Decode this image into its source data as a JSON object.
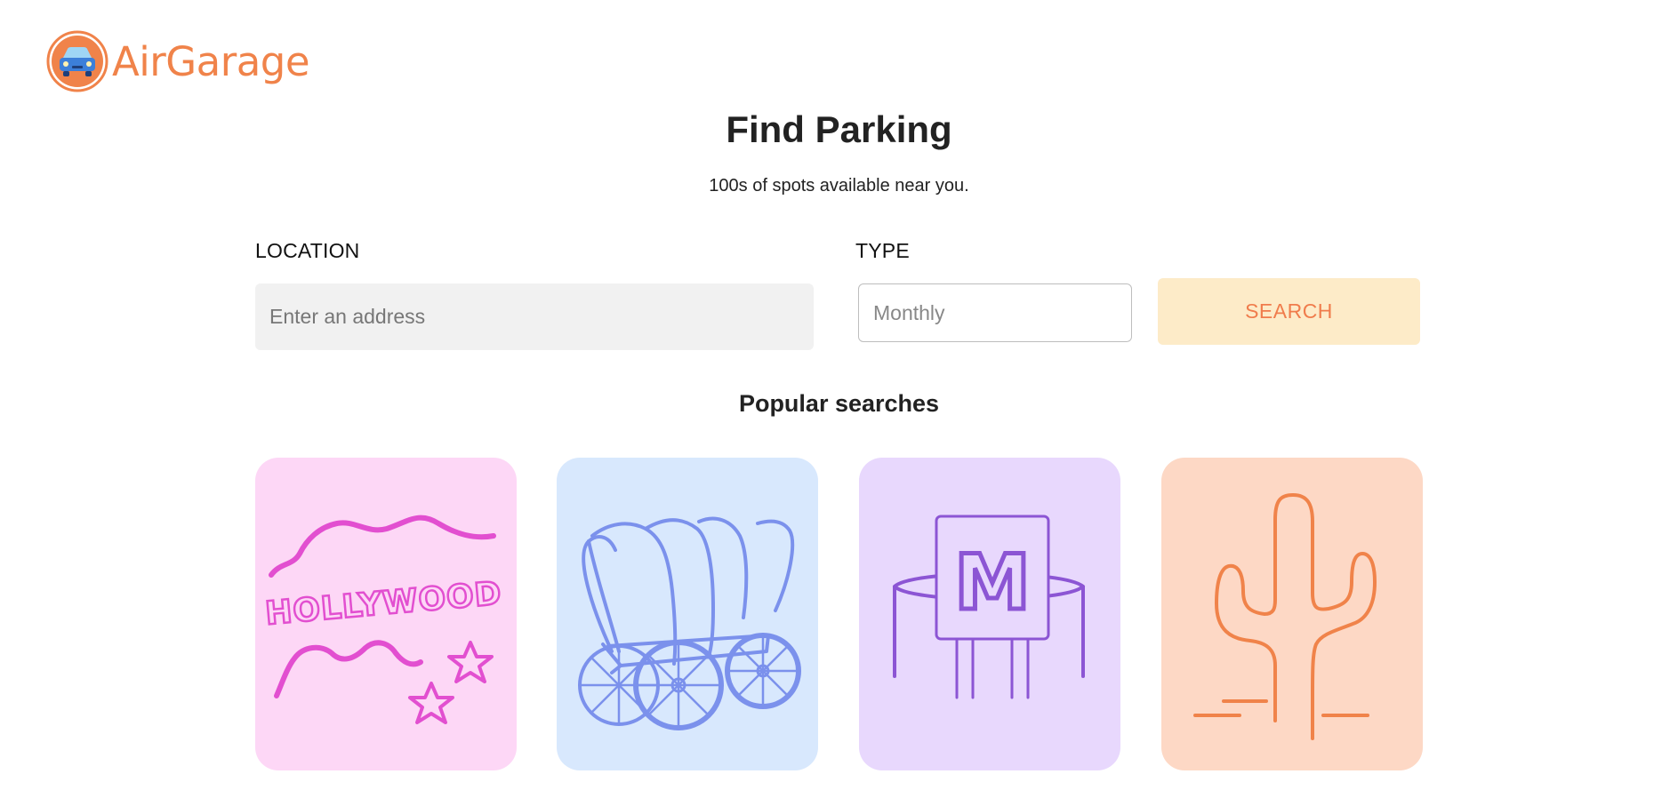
{
  "brand": {
    "name": "AirGarage",
    "color": "#f0834a",
    "logo_icon": "car-icon"
  },
  "hero": {
    "title": "Find Parking",
    "subtitle": "100s of spots available near you."
  },
  "search": {
    "location_label": "LOCATION",
    "location_placeholder": "Enter an address",
    "location_value": "",
    "type_label": "TYPE",
    "type_value": "Monthly",
    "button_label": "SEARCH",
    "button_bg": "#fdebc8",
    "button_text_color": "#f07c4c"
  },
  "popular": {
    "title": "Popular searches",
    "cards": [
      {
        "id": "hollywood",
        "illustration": "hollywood-sign-icon",
        "bg": "#fdd7f6",
        "stroke": "#e24fd0",
        "sign_text": "HOLLYWOOD"
      },
      {
        "id": "wagon",
        "illustration": "covered-wagon-icon",
        "bg": "#d8e8fd",
        "stroke": "#7b91ec"
      },
      {
        "id": "metro",
        "illustration": "metro-sign-icon",
        "bg": "#e8d8fd",
        "stroke": "#8c55d4",
        "sign_text": "M"
      },
      {
        "id": "cactus",
        "illustration": "cactus-icon",
        "bg": "#fdd8c5",
        "stroke": "#f0834a"
      }
    ]
  }
}
